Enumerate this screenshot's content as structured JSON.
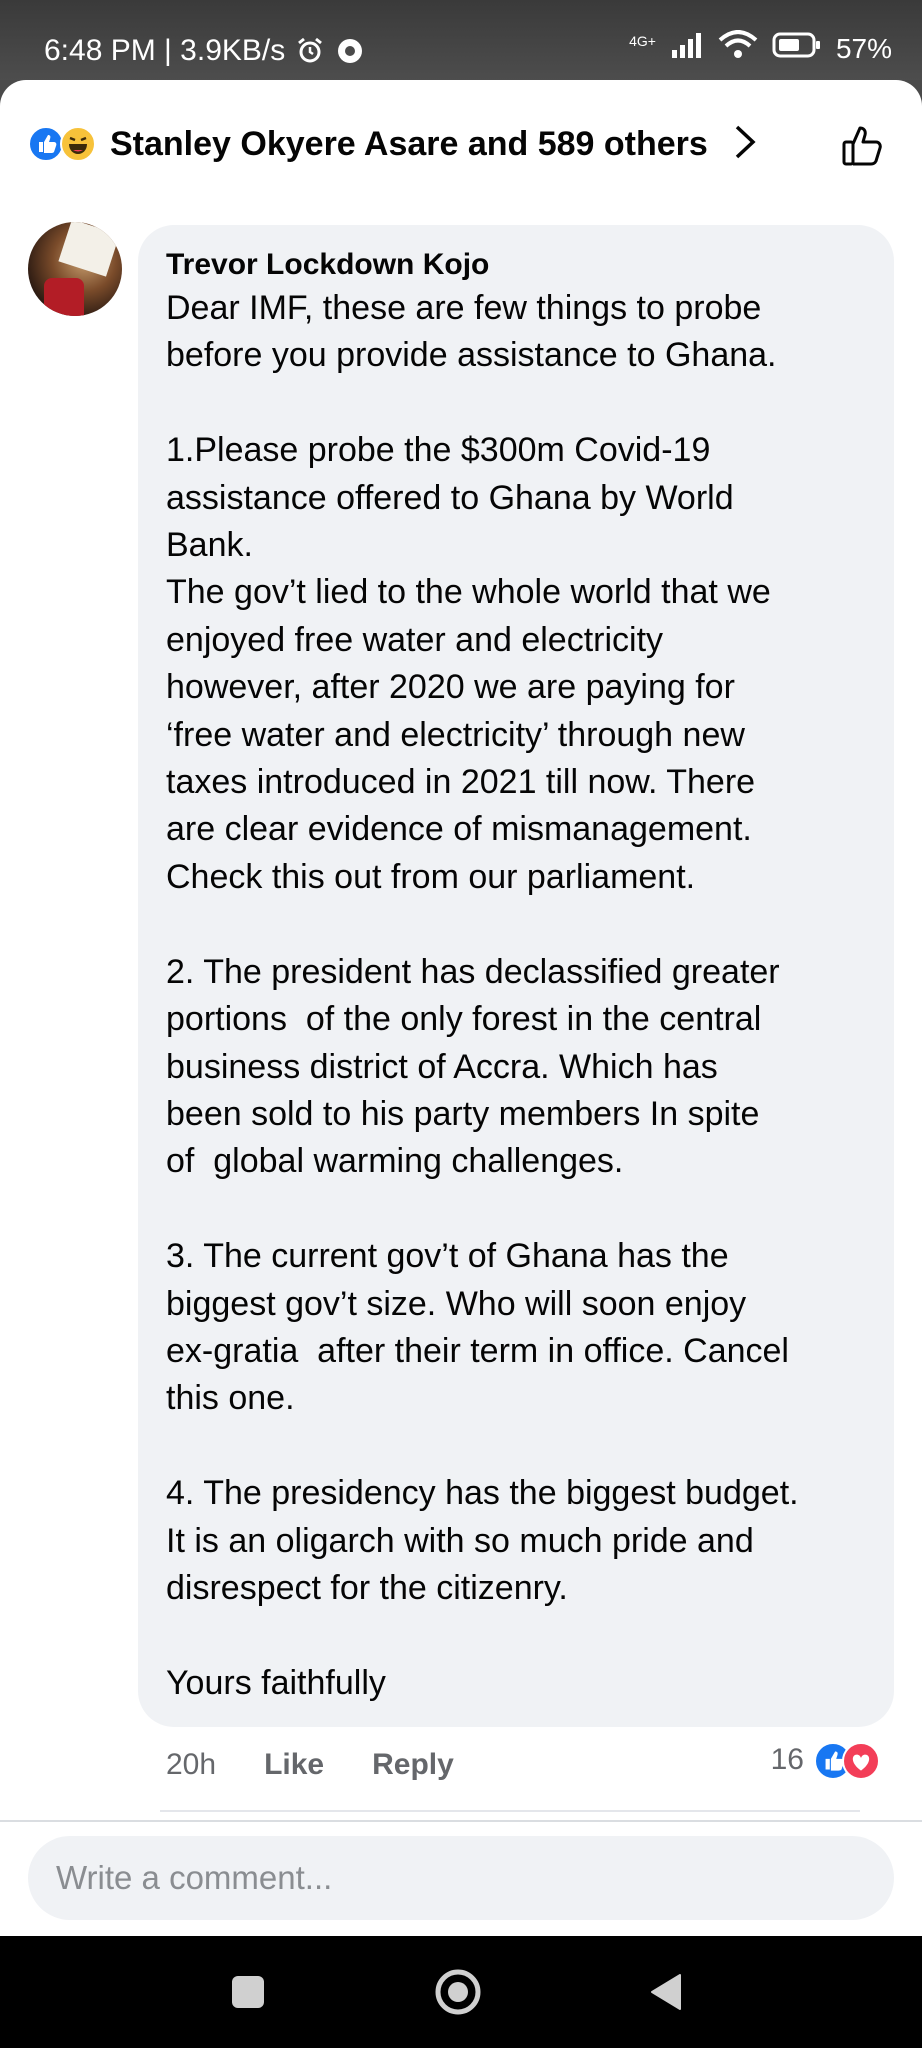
{
  "status_bar": {
    "time_speed": "6:48 PM | 3.9KB/s",
    "network": "4G+",
    "battery": "57%"
  },
  "header": {
    "reactions_text": "Stanley Okyere Asare and 589 others"
  },
  "comment": {
    "author": "Trevor Lockdown Kojo",
    "body": "Dear IMF, these are few things to probe\nbefore you provide assistance to Ghana.\n\n1.Please probe the $300m Covid-19\nassistance offered to Ghana by World\nBank.\nThe gov’t lied to the whole world that we\nenjoyed free water and electricity\nhowever, after 2020 we are paying for\n‘free water and electricity’ through new\ntaxes introduced in 2021 till now. There\nare clear evidence of mismanagement.\nCheck this out from our parliament.\n\n2. The president has declassified greater\nportions  of the only forest in the central\nbusiness district of Accra. Which has\nbeen sold to his party members In spite\nof  global warming challenges.\n\n3. The current gov’t of Ghana has the\nbiggest gov’t size. Who will soon enjoy\nex-gratia  after their term in office. Cancel\nthis one.\n\n4. The presidency has the biggest budget.\nIt is an oligarch with so much pride and\ndisrespect for the citizenry.\n\nYours faithfully",
    "time": "20h",
    "like_label": "Like",
    "reply_label": "Reply",
    "reaction_count": "16"
  },
  "composer": {
    "placeholder": "Write a comment..."
  },
  "colors": {
    "like_blue": "#1877f2",
    "love_red": "#f33e58",
    "haha_yellow": "#f7c23a",
    "bubble_bg": "#f0f2f5"
  },
  "icons": [
    "like-reaction-icon",
    "haha-reaction-icon",
    "love-reaction-icon",
    "chevron-right-icon",
    "thumbs-up-outline-icon",
    "alarm-icon",
    "whatsapp-icon",
    "signal-icon",
    "wifi-icon",
    "battery-icon",
    "recents-icon",
    "home-icon",
    "back-icon"
  ]
}
